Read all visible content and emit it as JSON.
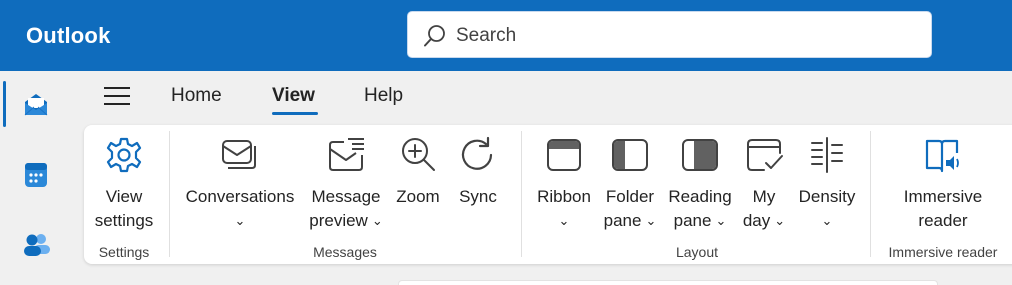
{
  "app": {
    "title": "Outlook"
  },
  "search": {
    "placeholder": "Search"
  },
  "colors": {
    "brand": "#0f6cbd",
    "surface": "#ffffff",
    "background": "#f0f0f0"
  },
  "rail": [
    {
      "name": "mail",
      "icon": "mail-icon",
      "active": true
    },
    {
      "name": "calendar",
      "icon": "calendar-icon",
      "active": false
    },
    {
      "name": "people",
      "icon": "people-icon",
      "active": false
    }
  ],
  "tabs": [
    {
      "label": "Home",
      "active": false
    },
    {
      "label": "View",
      "active": true
    },
    {
      "label": "Help",
      "active": false
    }
  ],
  "ribbon": {
    "settings": {
      "label": "Settings",
      "view_settings": {
        "line1": "View",
        "line2": "settings",
        "icon": "gear-icon"
      }
    },
    "messages": {
      "label": "Messages",
      "conversations": {
        "line1": "Conversations",
        "dropdown": true,
        "icon": "conversations-icon"
      },
      "message_preview": {
        "line1": "Message",
        "line2": "preview",
        "dropdown": true,
        "icon": "message-preview-icon"
      },
      "zoom": {
        "line1": "Zoom",
        "icon": "zoom-icon"
      },
      "sync": {
        "line1": "Sync",
        "icon": "sync-icon"
      }
    },
    "layout": {
      "label": "Layout",
      "ribbon": {
        "line1": "Ribbon",
        "dropdown": true,
        "icon": "ribbon-layout-icon"
      },
      "folder_pane": {
        "line1": "Folder",
        "line2": "pane",
        "dropdown": true,
        "icon": "folder-pane-icon"
      },
      "reading_pane": {
        "line1": "Reading",
        "line2": "pane",
        "dropdown": true,
        "icon": "reading-pane-icon"
      },
      "my_day": {
        "line1": "My",
        "line2": "day",
        "dropdown": true,
        "icon": "my-day-icon"
      },
      "density": {
        "line1": "Density",
        "dropdown": true,
        "icon": "density-icon"
      }
    },
    "immersive": {
      "label": "Immersive reader",
      "immersive_reader": {
        "line1": "Immersive",
        "line2": "reader",
        "icon": "immersive-reader-icon"
      }
    }
  }
}
